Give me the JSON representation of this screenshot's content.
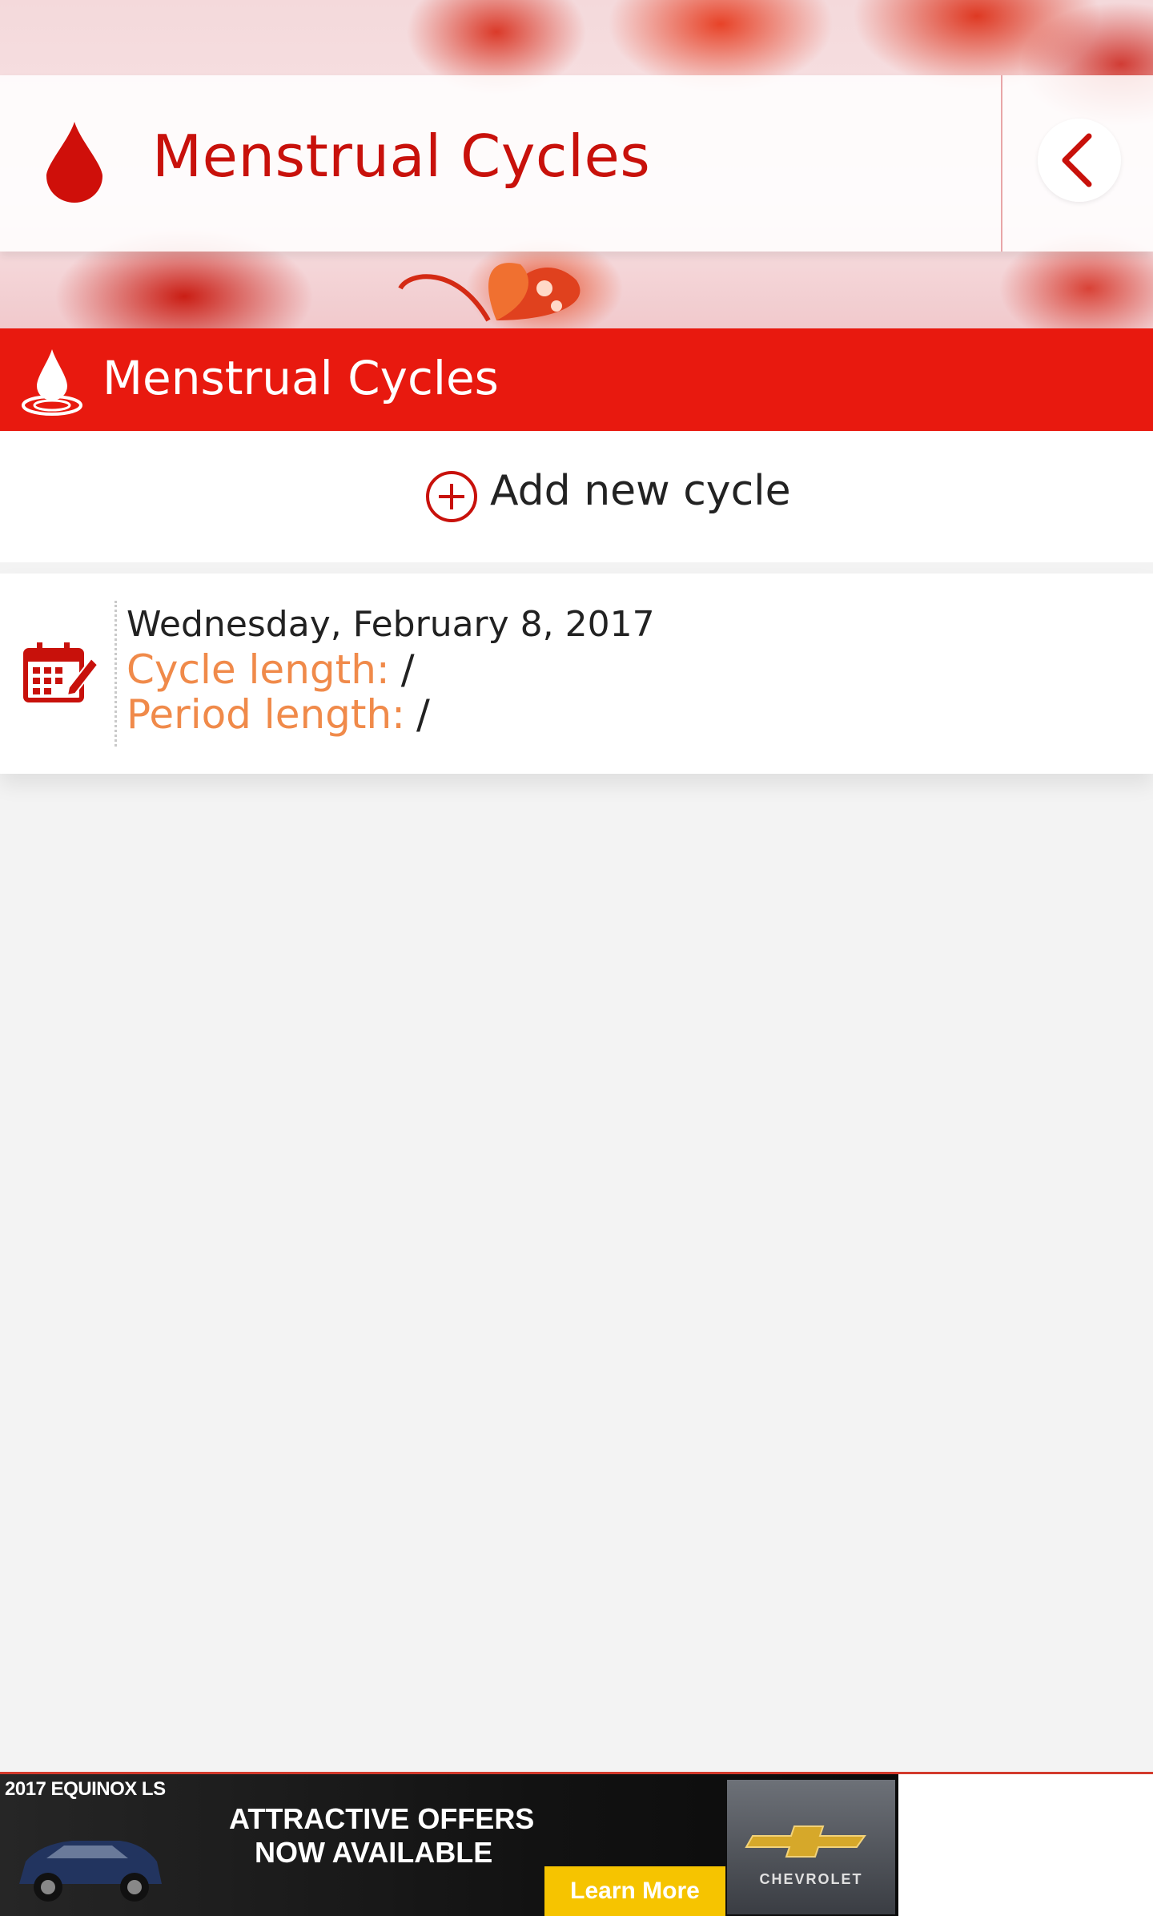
{
  "header": {
    "title": "Menstrual Cycles",
    "title_icon": "blood-drop-icon",
    "back_icon": "chevron-left-icon"
  },
  "section": {
    "title": "Menstrual Cycles",
    "icon": "water-drop-icon"
  },
  "actions": {
    "add_label": "Add new cycle",
    "add_icon": "plus-circle-icon"
  },
  "cycles": [
    {
      "date": "Wednesday, February 8, 2017",
      "cycle_length_label": "Cycle length:",
      "cycle_length_value": "/",
      "period_length_label": "Period length:",
      "period_length_value": "/",
      "icon": "calendar-edit-icon"
    }
  ],
  "ad": {
    "model": "2017 EQUINOX LS",
    "headline_line1": "ATTRACTIVE OFFERS",
    "headline_line2": "NOW AVAILABLE",
    "cta": "Learn More",
    "brand": "CHEVROLET"
  },
  "colors": {
    "primary_red": "#e8190f",
    "title_red": "#c8110b",
    "label_orange": "#f08a4a",
    "cta_yellow": "#f6c400"
  }
}
